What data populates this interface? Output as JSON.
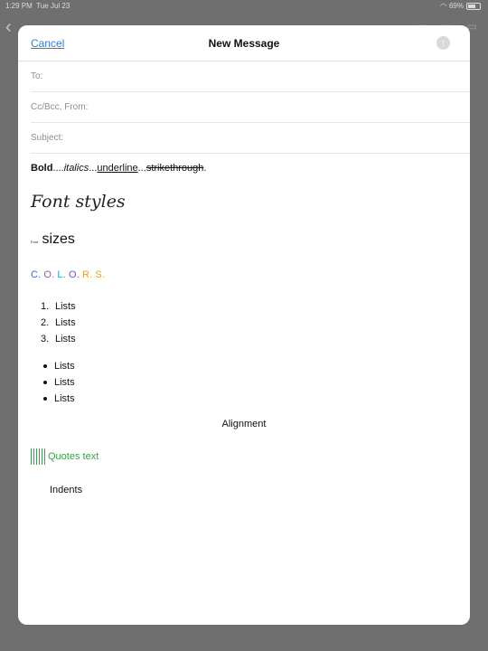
{
  "status_bar": {
    "time": "1:29 PM",
    "date": "Tue Jul 23",
    "battery": "69%"
  },
  "compose": {
    "cancel_label": "Cancel",
    "title": "New Message",
    "to_placeholder": "To:",
    "ccbcc_placeholder": "Cc/Bcc, From:",
    "subject_placeholder": "Subject:"
  },
  "body": {
    "styles": {
      "bold": "Bold",
      "sep1": "....",
      "italic": "italics",
      "sep2": "...",
      "underline": "underline",
      "sep3": "...",
      "strike": "strikethrough",
      "end": "."
    },
    "font_styles": "Font styles",
    "sizes_small": "Font",
    "sizes_large": "sizes",
    "colors": [
      {
        "text": "C.",
        "color": "#2f6fde"
      },
      {
        "text": "O.",
        "color": "#9b59b6"
      },
      {
        "text": "L.",
        "color": "#2aa6a6"
      },
      {
        "text": "O.",
        "color": "#7b4fd0"
      },
      {
        "text": "R.",
        "color": "#e6a41c"
      },
      {
        "text": "S.",
        "color": "#e6a41c"
      }
    ],
    "ordered_list": [
      "Lists",
      "Lists",
      "Lists"
    ],
    "bullet_list": [
      "Lists",
      "Lists",
      "Lists"
    ],
    "alignment": "Alignment",
    "quote": "Quotes text",
    "indent": "Indents"
  },
  "colors": {
    "accent": "#2f7de1",
    "quote": "#33a348"
  }
}
